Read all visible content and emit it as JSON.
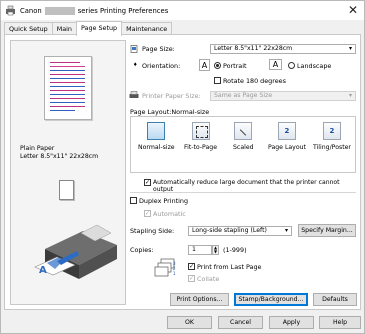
{
  "window": {
    "title_prefix": "Canon",
    "title_suffix": "series Printing Preferences",
    "close_glyph": "✕"
  },
  "tabs": [
    {
      "label": "Quick Setup"
    },
    {
      "label": "Main"
    },
    {
      "label": "Page Setup"
    },
    {
      "label": "Maintenance"
    }
  ],
  "preview": {
    "media_line1": "Plain Paper",
    "media_line2": "Letter 8.5\"x11\" 22x28cm"
  },
  "page_size": {
    "label": "Page Size:",
    "value": "Letter 8.5\"x11\" 22x28cm"
  },
  "orientation": {
    "label": "Orientation:",
    "portrait": "Portrait",
    "landscape": "Landscape",
    "selected": "Portrait",
    "portrait_icon_letter": "A",
    "landscape_icon_letter": "A",
    "rotate_label": "Rotate 180 degrees"
  },
  "printer_paper_size": {
    "label": "Printer Paper Size:",
    "value": "Same as Page Size"
  },
  "page_layout": {
    "label": "Page Layout:",
    "current": "Normal-size",
    "options": [
      {
        "label": "Normal-size"
      },
      {
        "label": "Fit-to-Page"
      },
      {
        "label": "Scaled"
      },
      {
        "label": "Page Layout"
      },
      {
        "label": "Tiling/Poster"
      }
    ],
    "tile_numbers": [
      "2",
      "2"
    ]
  },
  "auto_reduce": {
    "label": "Automatically reduce large document that the printer cannot output",
    "checked": true
  },
  "duplex": {
    "label": "Duplex Printing",
    "checked": false,
    "automatic_label": "Automatic",
    "automatic_checked": true
  },
  "stapling": {
    "label": "Stapling Side:",
    "value": "Long-side stapling (Left)",
    "margin_button": "Specify Margin..."
  },
  "copies": {
    "label": "Copies:",
    "value": "1",
    "range": "(1-999)",
    "print_from_last": "Print from Last Page",
    "print_from_last_checked": true,
    "collate": "Collate",
    "collate_checked": true
  },
  "buttons": {
    "print_options": "Print Options...",
    "stamp_background": "Stamp/Background...",
    "defaults": "Defaults",
    "ok": "OK",
    "cancel": "Cancel",
    "apply": "Apply",
    "help": "Help"
  },
  "icons": {
    "dropdown_arrow": "▾",
    "check": "✓"
  },
  "colors": {
    "accent": "#0078d7",
    "printer_blue": "#2d6cc4"
  }
}
